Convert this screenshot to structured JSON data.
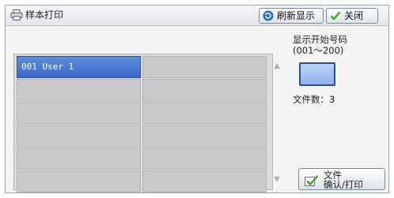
{
  "header": {
    "title": "样本打印",
    "refresh_label": "刷新显示",
    "close_label": "关闭"
  },
  "list": {
    "cells": [
      "001 User 1",
      "",
      "",
      "",
      "",
      "",
      "",
      "",
      "",
      "",
      "",
      ""
    ],
    "selected_index": 0
  },
  "side": {
    "start_number_label": "显示开始号码",
    "start_number_range": "(001～200)",
    "start_number_value": "",
    "file_count": "文件数：3",
    "confirm_line1": "文件",
    "confirm_line2": "确认/打印"
  },
  "icons": {
    "title": "printer-icon",
    "refresh": "refresh-icon",
    "close": "check-icon",
    "scroll_up": "scroll-up-arrow-icon",
    "scroll_down": "scroll-down-arrow-icon",
    "confirm": "check-icon"
  },
  "colors": {
    "selected_row": "#4a78d0",
    "input_fill": "#a9c4f1",
    "check_green": "#3aa52a"
  }
}
